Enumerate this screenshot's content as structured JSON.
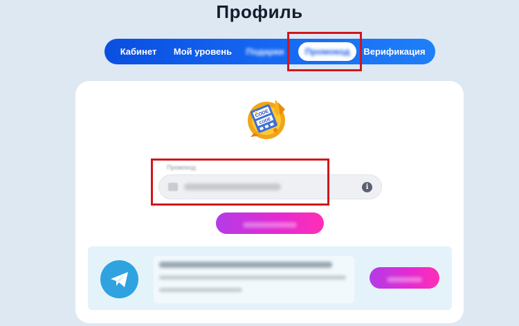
{
  "page": {
    "title": "Профиль"
  },
  "tabs": [
    {
      "label": "Кабинет"
    },
    {
      "label": "Мой уровень"
    },
    {
      "label": "Подарки"
    },
    {
      "label": "Промокод"
    },
    {
      "label": "Верификация"
    }
  ],
  "promo": {
    "art_text_1": "CODE",
    "art_text_2": "CODE",
    "field_label": "Промокод",
    "info_glyph": "i"
  },
  "icons": {
    "telegram": "telegram-icon",
    "info": "info-icon",
    "ticket": "ticket-icon"
  },
  "colors": {
    "background": "#dde8f2",
    "tabbar_start": "#0a4fe0",
    "tabbar_end": "#1f7ff8",
    "button_start": "#b43be6",
    "button_end": "#ff2fb6",
    "highlight": "#d0161c",
    "telegram": "#2ea3e0"
  }
}
